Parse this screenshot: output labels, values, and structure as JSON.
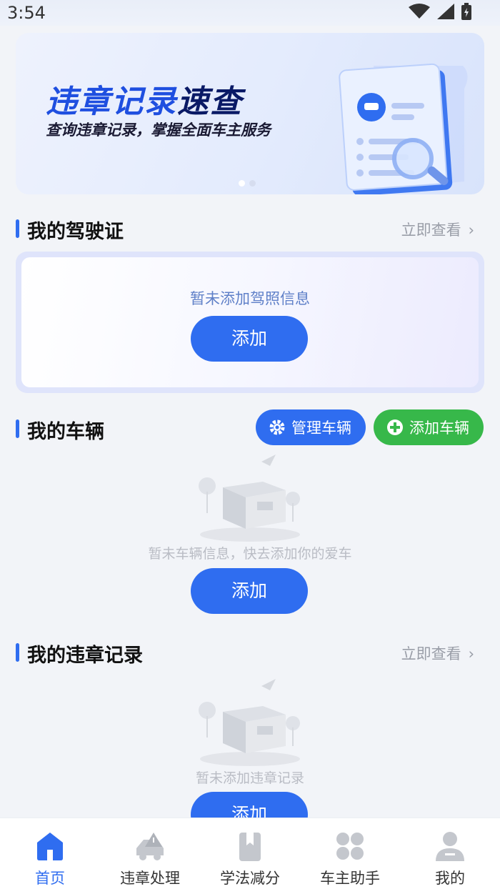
{
  "status": {
    "time": "3:54"
  },
  "banner": {
    "title_main": "违章记录",
    "title_accent": "速查",
    "subtitle": "查询违章记录，掌握全面车主服务"
  },
  "license": {
    "title": "我的驾驶证",
    "link": "立即查看",
    "empty": "暂未添加驾照信息",
    "add_label": "添加"
  },
  "vehicles": {
    "title": "我的车辆",
    "manage_label": "管理车辆",
    "add_vehicle_label": "添加车辆",
    "empty": "暂未车辆信息，快去添加你的爱车",
    "add_label": "添加"
  },
  "violations": {
    "title": "我的违章记录",
    "link": "立即查看",
    "empty": "暂未添加违章记录",
    "add_label": "添加"
  },
  "tabbar": {
    "items": [
      {
        "label": "首页",
        "icon": "home-icon",
        "active": true
      },
      {
        "label": "违章处理",
        "icon": "car-warning-icon",
        "active": false
      },
      {
        "label": "学法减分",
        "icon": "book-icon",
        "active": false
      },
      {
        "label": "车主助手",
        "icon": "grid-icon",
        "active": false
      },
      {
        "label": "我的",
        "icon": "user-icon",
        "active": false
      }
    ]
  },
  "colors": {
    "primary": "#2f6df0",
    "green": "#37b84a"
  }
}
